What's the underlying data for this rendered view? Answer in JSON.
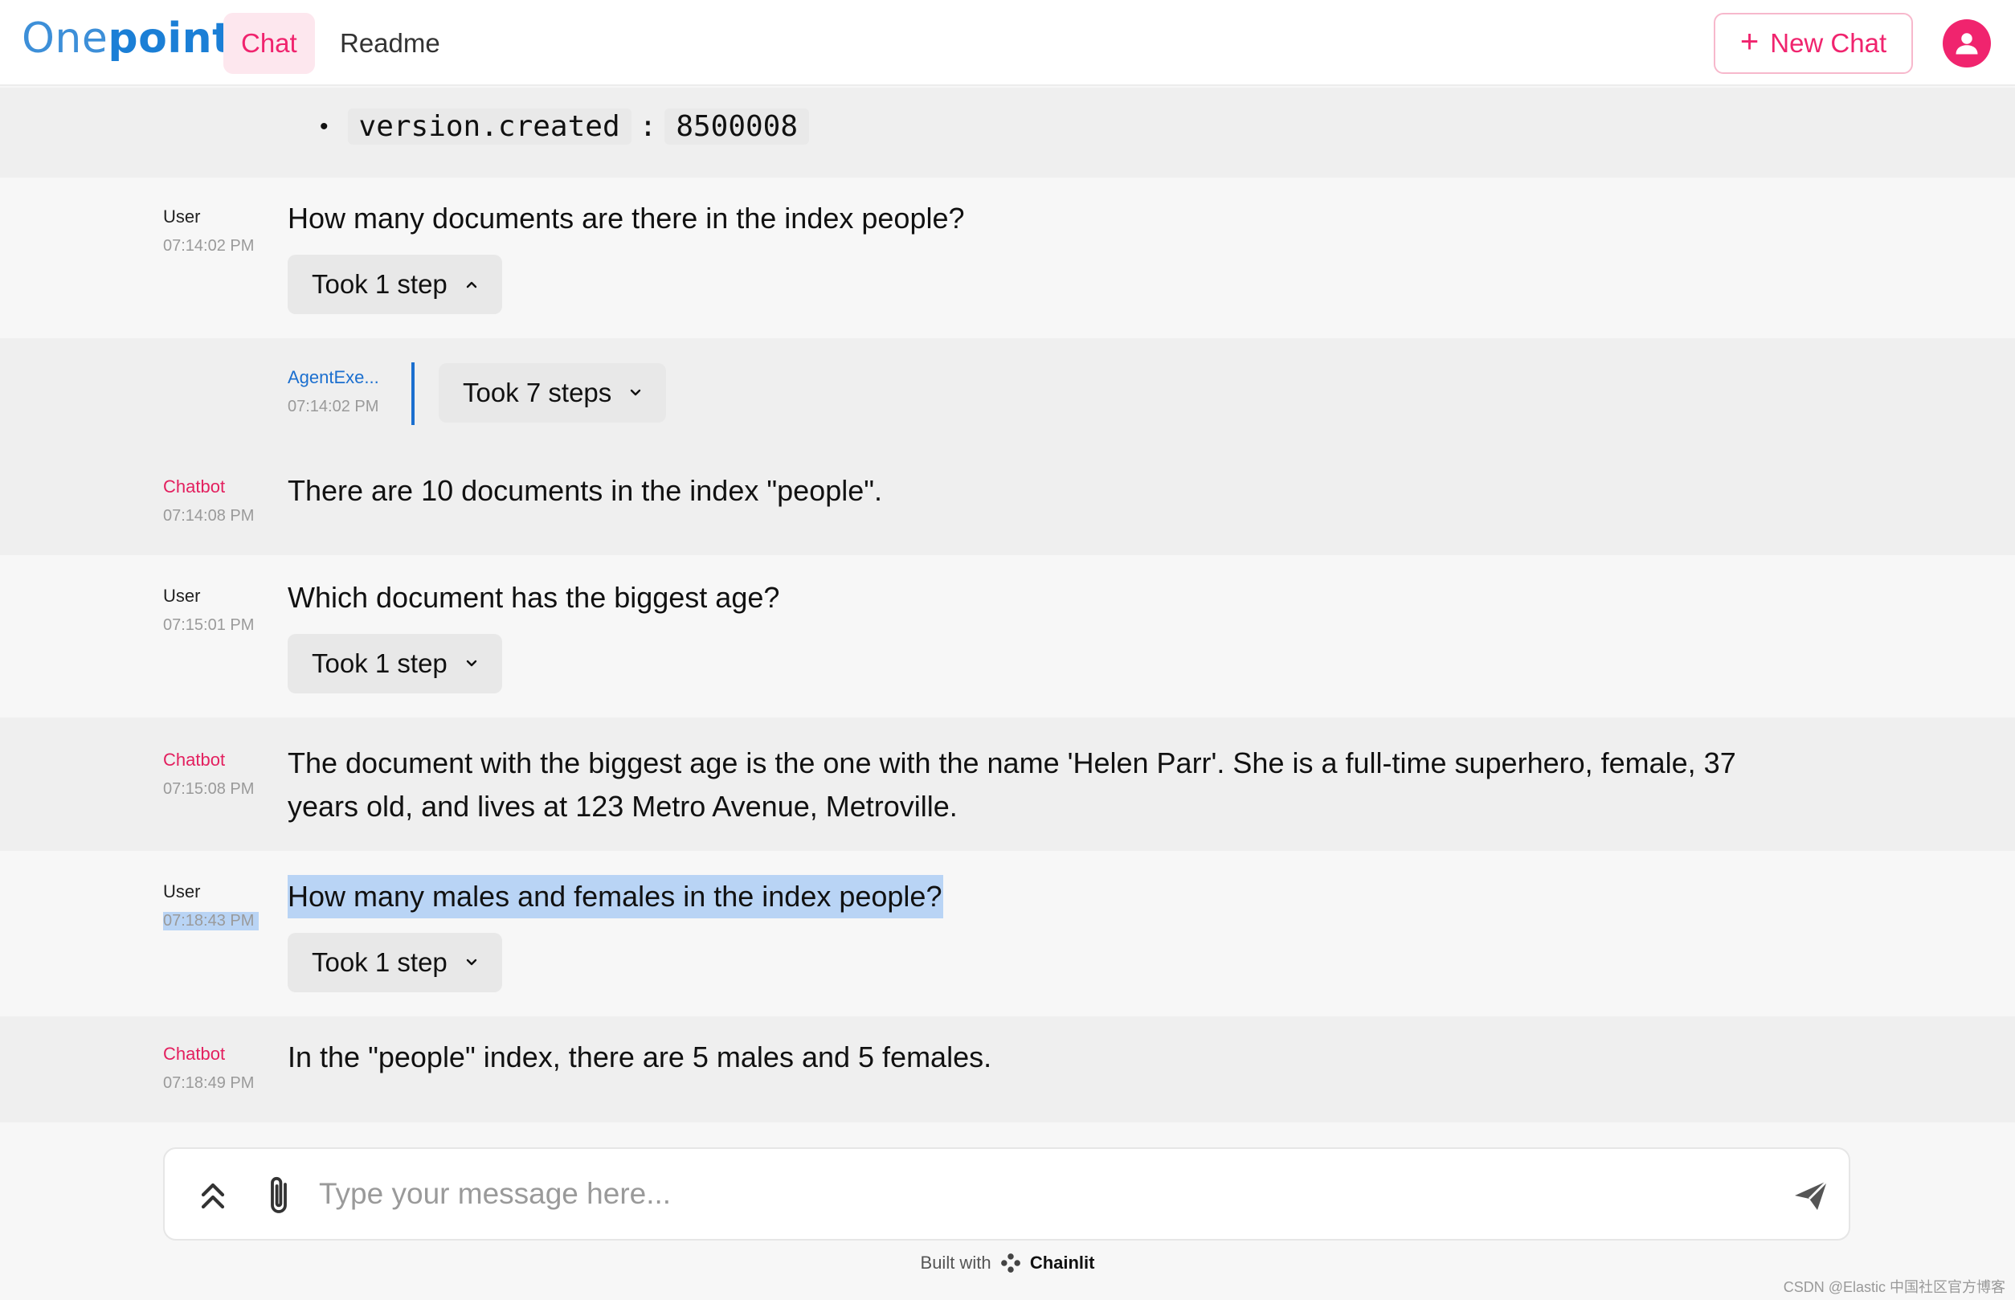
{
  "header": {
    "logo_one": "One",
    "logo_point": "point",
    "tabs": [
      {
        "label": "Chat",
        "active": true
      },
      {
        "label": "Readme",
        "active": false
      }
    ],
    "new_chat_label": "New Chat",
    "accent_color": "#f0246e",
    "brand_color": "#1b7fd6"
  },
  "top_fragment": {
    "key": "version.created",
    "separator": ":",
    "value": "8500008"
  },
  "messages": [
    {
      "author": "User",
      "time": "07:14:02 PM",
      "text": "How many documents are there in the index people?",
      "steps": "Took 1 step",
      "steps_expanded": true
    },
    {
      "author": "AgentExe...",
      "time": "07:14:02 PM",
      "steps": "Took 7 steps",
      "steps_expanded": false
    },
    {
      "author": "Chatbot",
      "time": "07:14:08 PM",
      "text": "There are 10 documents in the index \"people\"."
    },
    {
      "author": "User",
      "time": "07:15:01 PM",
      "text": "Which document has the biggest age?",
      "steps": "Took 1 step",
      "steps_expanded": false
    },
    {
      "author": "Chatbot",
      "time": "07:15:08 PM",
      "text_line1": "The document with the biggest age is the one with the name 'Helen Parr'. She is a full-time superhero, female, 37",
      "text_line2": "years old, and lives at 123 Metro Avenue, Metroville."
    },
    {
      "author": "User",
      "time": "07:18:43 PM",
      "text": "How many males and females in the index people?",
      "steps": "Took 1 step",
      "steps_expanded": false,
      "selected": true
    },
    {
      "author": "Chatbot",
      "time": "07:18:49 PM",
      "text": "In the \"people\" index, there are 5 males and 5 females."
    }
  ],
  "composer": {
    "placeholder": "Type your message here...",
    "value": ""
  },
  "footer": {
    "built_with": "Built with",
    "brand": "Chainlit"
  },
  "watermark": "CSDN @Elastic 中国社区官方博客"
}
